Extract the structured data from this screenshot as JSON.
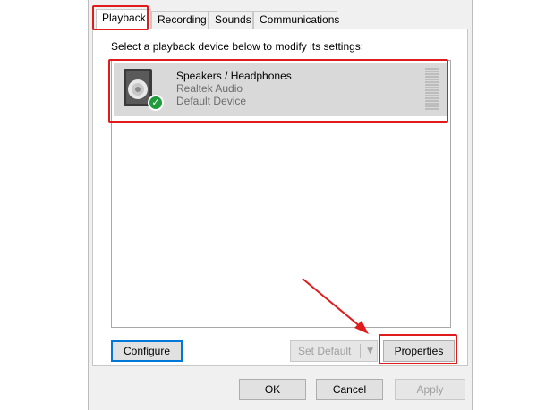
{
  "tabs": [
    {
      "label": "Playback",
      "active": true
    },
    {
      "label": "Recording",
      "active": false
    },
    {
      "label": "Sounds",
      "active": false
    },
    {
      "label": "Communications",
      "active": false
    }
  ],
  "instruction": "Select a playback device below to modify its settings:",
  "device": {
    "name": "Speakers / Headphones",
    "driver": "Realtek Audio",
    "status": "Default Device",
    "icon": "speaker-icon",
    "status_icon": "check-icon"
  },
  "buttons": {
    "configure": "Configure",
    "set_default": "Set Default",
    "properties": "Properties",
    "ok": "OK",
    "cancel": "Cancel",
    "apply": "Apply"
  },
  "colors": {
    "highlight": "#e01b1b",
    "selection": "#d9d9d9",
    "default_check": "#1e9c3c",
    "focus": "#0078d7"
  }
}
